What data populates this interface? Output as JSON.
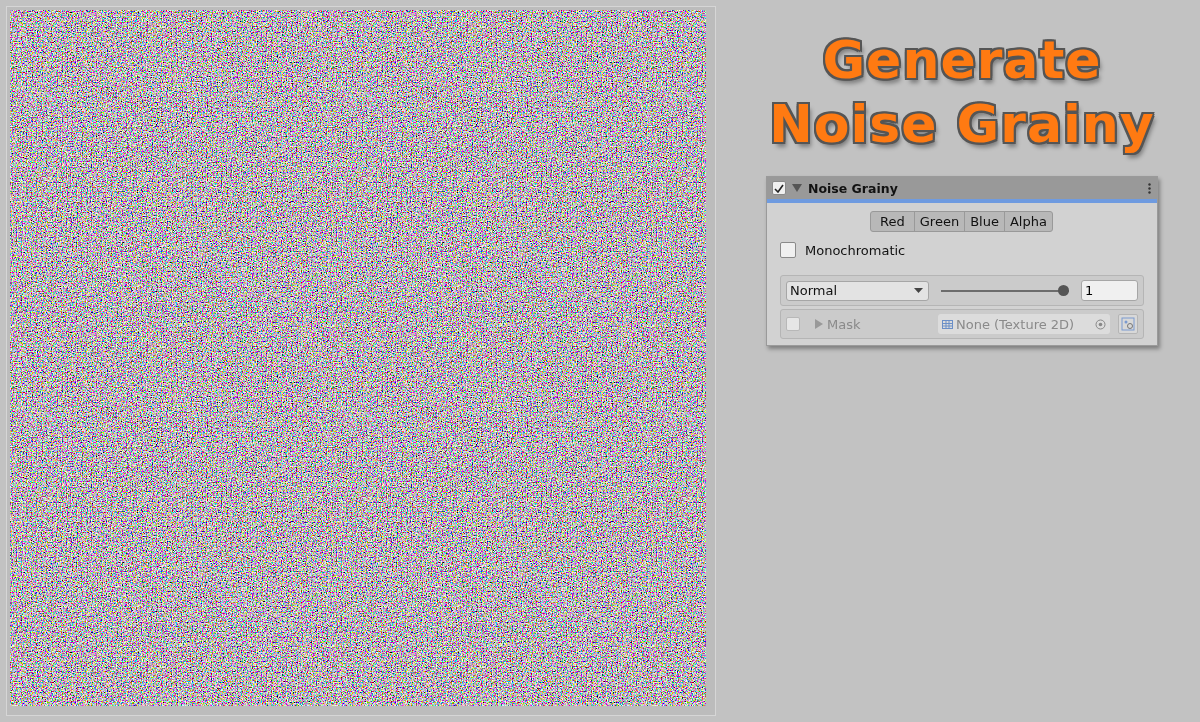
{
  "title_lines": [
    "Generate",
    "Noise Grainy"
  ],
  "component": {
    "enabled": true,
    "expanded": true,
    "name": "Noise Grainy",
    "channels": [
      {
        "label": "Red",
        "selected": true
      },
      {
        "label": "Green",
        "selected": true
      },
      {
        "label": "Blue",
        "selected": true
      },
      {
        "label": "Alpha",
        "selected": true
      }
    ],
    "monochromatic": {
      "label": "Monochromatic",
      "checked": false
    },
    "blend": {
      "mode": "Normal",
      "level": 1,
      "value": "1"
    },
    "mask": {
      "enabled": false,
      "disabled": true,
      "label": "Mask",
      "texture": "None (Texture 2D)"
    }
  }
}
